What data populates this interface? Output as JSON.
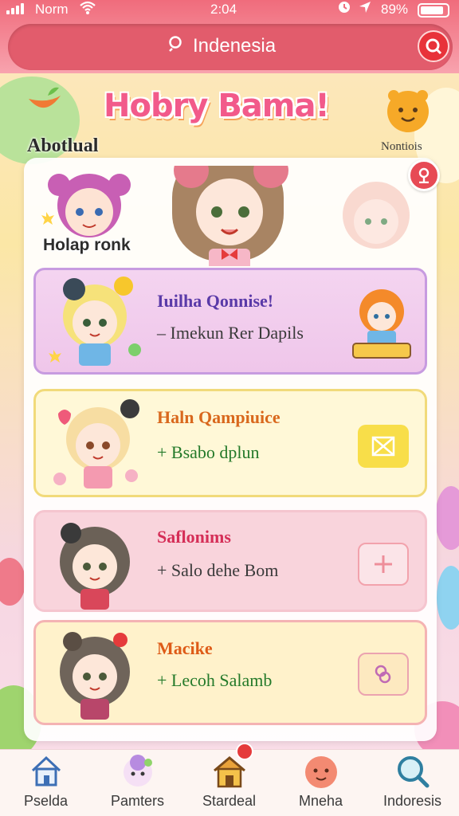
{
  "status_bar": {
    "carrier": "Norm",
    "time": "2:04",
    "battery": "89%"
  },
  "search": {
    "query": "Indenesia",
    "icon": "search-icon",
    "action_icon": "search-go-icon"
  },
  "header": {
    "title": "Hobry Bama!",
    "section_label": "Abotlual",
    "mascot_label": "Nontiois"
  },
  "hero": {
    "label": "Holap ronk"
  },
  "cards": [
    {
      "title": "Iuilha Qonnise!",
      "subtitle": "– Imekun Rer Dapils",
      "action_icon": "badge-icon"
    },
    {
      "title": "Haln Qampiuice",
      "subtitle": "+ Bsabo dplun",
      "action_icon": "image-off-icon"
    },
    {
      "title": "Saflonims",
      "subtitle": "+ Salo dehe Bom",
      "action_icon": "plus-icon"
    },
    {
      "title": "Macike",
      "subtitle": "+ Lecoh Salamb",
      "action_icon": "sticker-icon"
    }
  ],
  "nav": [
    {
      "label": "Pselda",
      "icon": "home-icon"
    },
    {
      "label": "Pamters",
      "icon": "pet-icon"
    },
    {
      "label": "Stardeal",
      "icon": "house-icon"
    },
    {
      "label": "Mneha",
      "icon": "face-icon"
    },
    {
      "label": "Indoresis",
      "icon": "search-icon"
    }
  ],
  "colors": {
    "header": "#f06c7c",
    "accent": "#e8333a",
    "card1": "#f4d4f0",
    "card2": "#fff8d7",
    "card3": "#f9d4dc",
    "card4": "#fff2cb"
  }
}
